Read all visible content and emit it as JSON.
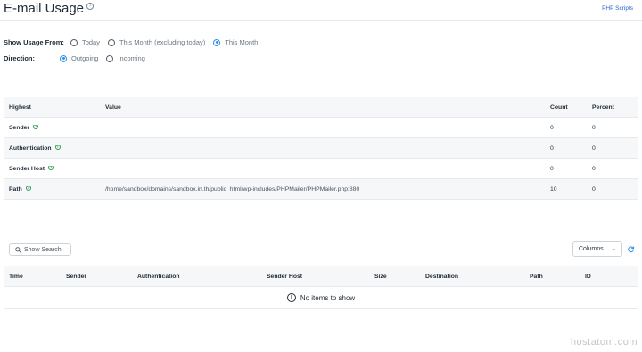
{
  "header": {
    "title": "E-mail Usage",
    "help_icon": "question-circle-icon",
    "php_scripts_link": "PHP Scripts"
  },
  "options": {
    "usage_label": "Show Usage From:",
    "usage_choices": [
      {
        "label": "Today",
        "selected": false
      },
      {
        "label": "This Month (excluding today)",
        "selected": false
      },
      {
        "label": "This Month",
        "selected": true
      }
    ],
    "direction_label": "Direction:",
    "direction_choices": [
      {
        "label": "Outgoing",
        "selected": true
      },
      {
        "label": "Incoming",
        "selected": false
      }
    ]
  },
  "summary_table": {
    "columns": [
      "Highest",
      "Value",
      "Count",
      "Percent"
    ],
    "rows": [
      {
        "highest": "Sender",
        "value": "",
        "count": "0",
        "percent": "0"
      },
      {
        "highest": "Authentication",
        "value": "",
        "count": "0",
        "percent": "0"
      },
      {
        "highest": "Sender Host",
        "value": "",
        "count": "0",
        "percent": "0"
      },
      {
        "highest": "Path",
        "value": "/home/sandbox/domains/sandbox.in.th/public_html/wp-includes/PHPMailer/PHPMailer.php:880",
        "count": "10",
        "percent": "0"
      }
    ]
  },
  "log_toolbar": {
    "search_label": "Show Search",
    "columns_label": "Columns",
    "columns_caret": "⌄"
  },
  "log_table": {
    "columns": [
      "Time",
      "Sender",
      "Authentication",
      "Sender Host",
      "Size",
      "Destination",
      "Path",
      "ID"
    ],
    "empty_message": "No items to show"
  },
  "watermark": "hostatom.com",
  "colors": {
    "accent": "#2f8fe6",
    "link": "#1f63c8",
    "info_green": "#2c9b56",
    "row_alt": "#f6f7f9"
  }
}
